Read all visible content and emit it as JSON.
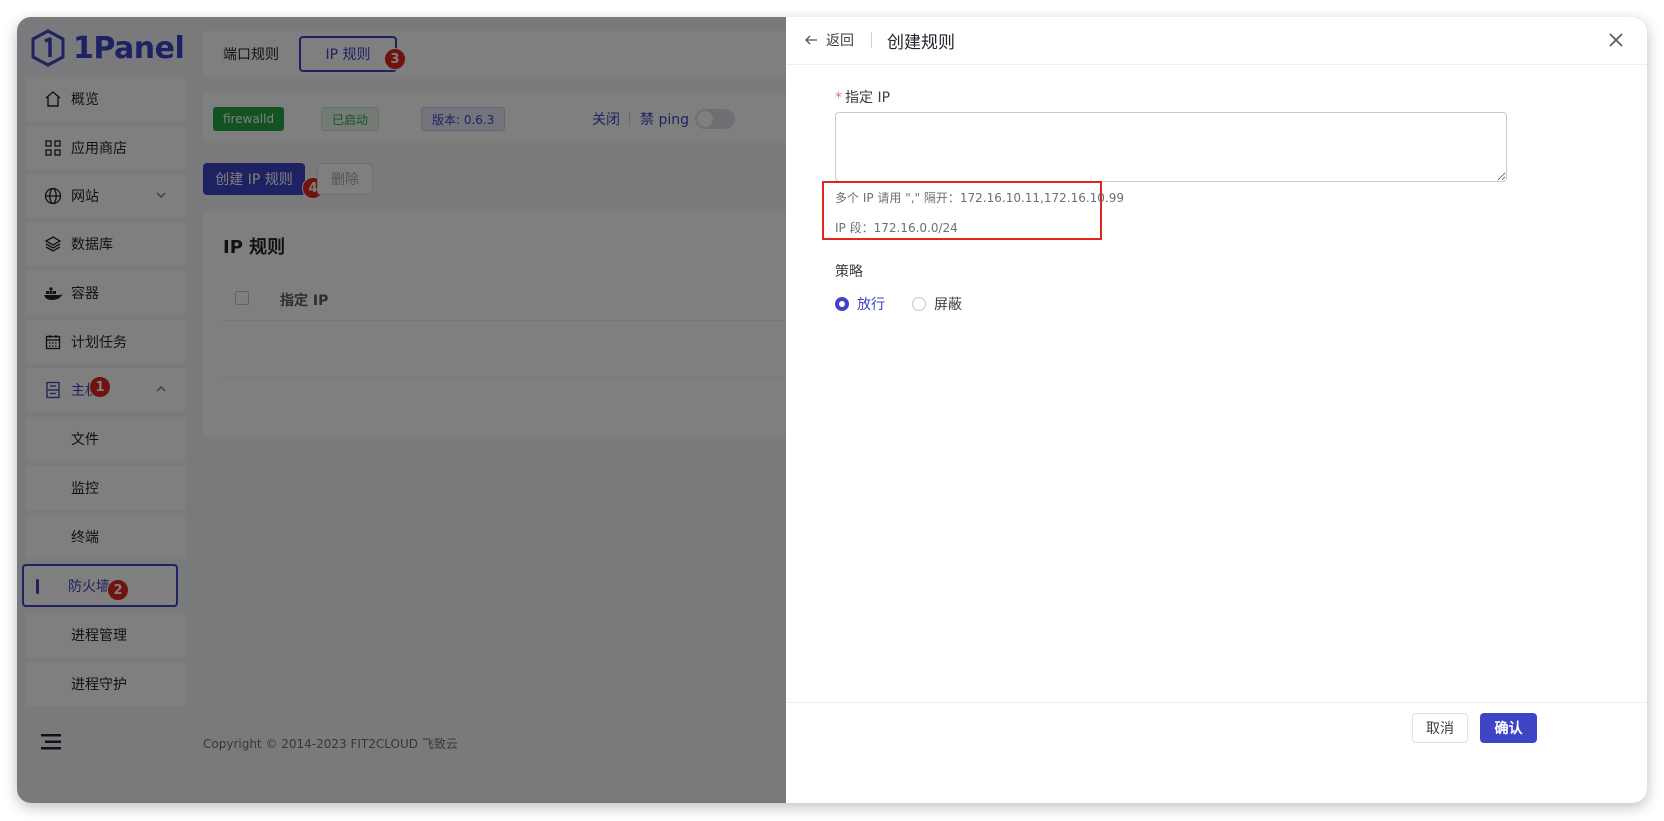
{
  "app": {
    "logo_text": "1Panel"
  },
  "sidebar": {
    "items": [
      {
        "label": "概览",
        "icon": "home-icon"
      },
      {
        "label": "应用商店",
        "icon": "grid-icon"
      },
      {
        "label": "网站",
        "icon": "globe-icon"
      },
      {
        "label": "数据库",
        "icon": "layers-icon"
      },
      {
        "label": "容器",
        "icon": "docker-icon"
      },
      {
        "label": "计划任务",
        "icon": "calendar-icon"
      },
      {
        "label": "主机",
        "icon": "server-icon"
      }
    ],
    "sub_items": [
      {
        "label": "文件"
      },
      {
        "label": "监控"
      },
      {
        "label": "终端"
      },
      {
        "label": "防火墙"
      },
      {
        "label": "进程管理"
      },
      {
        "label": "进程守护"
      }
    ]
  },
  "badges": {
    "b1": "1",
    "b2": "2",
    "b3": "3",
    "b4": "4"
  },
  "main": {
    "tabs": [
      {
        "label": "端口规则"
      },
      {
        "label": "IP 规则"
      }
    ],
    "status": {
      "firewall_tag": "firewalld",
      "running_tag": "已启动",
      "version_tag": "版本: 0.6.3",
      "close_link": "关闭",
      "ping_label": "禁 ping"
    },
    "buttons": {
      "create": "创建 IP 规则",
      "delete": "删除"
    },
    "card_title": "IP 规则",
    "table_columns": [
      "指定 IP"
    ],
    "footer": "Copyright © 2014-2023 FIT2CLOUD 飞致云"
  },
  "drawer": {
    "back_label": "返回",
    "title": "创建规则",
    "ip_label": "指定 IP",
    "ip_value": "",
    "hint_multi": "多个 IP 请用 \",\" 隔开：172.16.10.11,172.16.10.99",
    "hint_range": "IP 段：172.16.0.0/24",
    "policy_label": "策略",
    "policy_options": [
      "放行",
      "屏蔽"
    ],
    "policy_selected": "放行",
    "cancel": "取消",
    "confirm": "确认"
  },
  "colors": {
    "primary": "#3d45c4",
    "badge": "#e1251b",
    "highlight_box": "#e1251b"
  }
}
